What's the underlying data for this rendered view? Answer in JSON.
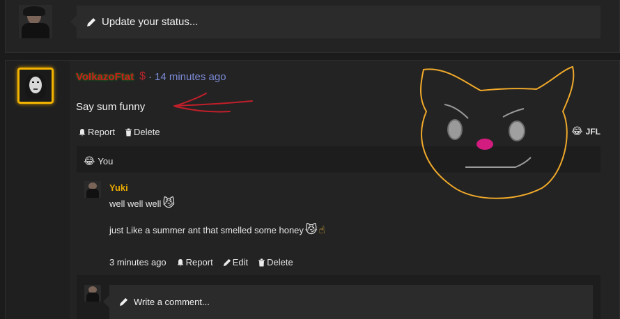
{
  "status": {
    "placeholder": "Update your status..."
  },
  "post": {
    "username": "VoIkazoFtat",
    "dollar": "$",
    "separator": "·",
    "time": "14 minutes ago",
    "text": "Say sum funny",
    "actions": {
      "report": "Report",
      "delete": "Delete"
    },
    "reaction": {
      "label": "JFL",
      "emoji": "😂"
    }
  },
  "reactions_row": {
    "emoji": "😂",
    "label": "You"
  },
  "comment": {
    "author": "Yuki",
    "line1": "well well well",
    "line1_emoji": "😼",
    "line2": "just Like a summer ant that smelled some honey",
    "line2_emojis": [
      "😼",
      "☝"
    ],
    "time": "3 minutes ago",
    "actions": {
      "report": "Report",
      "edit": "Edit",
      "delete": "Delete"
    }
  },
  "write_comment": {
    "placeholder": "Write a comment..."
  },
  "colors": {
    "username": "#cc1a1a",
    "time": "#7b8ad6",
    "author": "#e7a900",
    "avatar_border": "#f2b300",
    "annotation_arrow": "#c21f2a",
    "annotation_doodle": "#f0a92a"
  }
}
